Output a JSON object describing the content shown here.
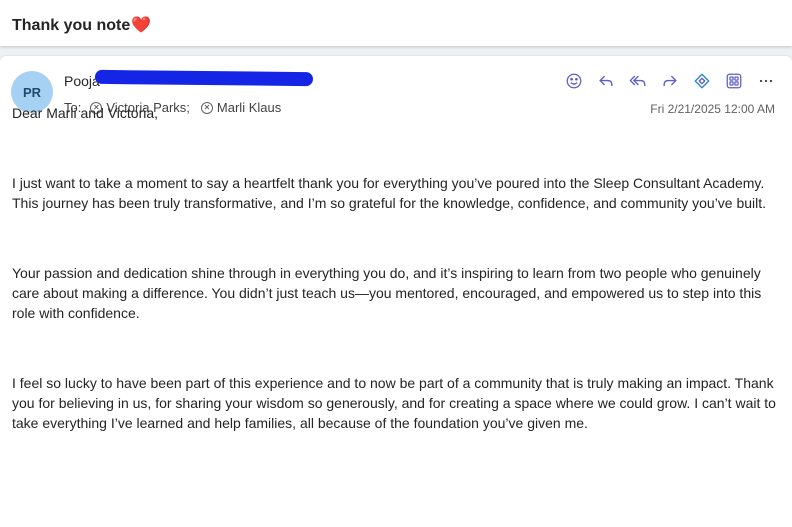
{
  "subject": {
    "text": "Thank you note",
    "emoji": "❤️"
  },
  "sender": {
    "initials": "PR",
    "name_visible": "Pooja",
    "avatar_color": "#a6d1f2"
  },
  "recipients": {
    "label": "To:",
    "items": [
      "Victoria Parks;",
      "Marli Klaus"
    ]
  },
  "toolbar": {
    "icons": [
      "emoji-icon",
      "reply-icon",
      "reply-all-icon",
      "forward-icon",
      "loop-icon",
      "apps-icon",
      "more-icon"
    ],
    "accent": "#5b5fc7"
  },
  "timestamp": "Fri 2/21/2025 12:00 AM",
  "body": {
    "greeting": "Dear Marli and Victoria,",
    "paragraphs": [
      "I just want to take a moment to say a heartfelt thank you for everything you’ve poured into the Sleep Consultant Academy. This journey has been truly transformative, and I’m so grateful for the knowledge, confidence, and community you’ve built.",
      "Your passion and dedication shine through in everything you do, and it’s inspiring to learn from two people who genuinely care about making a difference. You didn’t just teach us—you mentored, encouraged, and empowered us to step into this role with confidence.",
      "I feel so lucky to have been part of this experience and to now be part of a community that is truly making an impact. Thank you for believing in us, for sharing your wisdom so generously, and for creating a space where we could grow. I can’t wait to take everything I’ve learned and help families, all because of the foundation you’ve given me."
    ]
  }
}
